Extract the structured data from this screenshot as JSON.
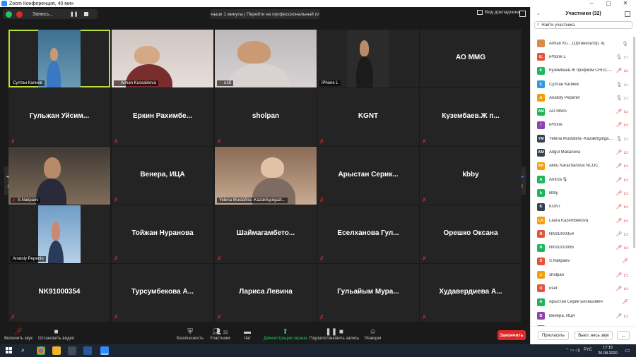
{
  "window": {
    "title": "Zoom Конференция, 40 мин"
  },
  "topbar": {
    "recording_label": "Запись...",
    "time_notice": "Меньше 1 минуты | Перейти на профессиональный план",
    "view_label": "Вид докладчика"
  },
  "pager": {
    "left": "1/2",
    "right": "1/2"
  },
  "tiles": [
    {
      "name": "Султан Калиев",
      "video": true,
      "muted": false,
      "active": true
    },
    {
      "name": "Aiman Kussainova",
      "video": true,
      "muted": true
    },
    {
      "name": "u18",
      "video": true,
      "muted": true
    },
    {
      "name": "iPhone L",
      "video": true,
      "muted": false
    },
    {
      "name": "АО MMG",
      "video": false,
      "muted": false
    },
    {
      "name": "Гульжан Уйсим...",
      "video": false,
      "muted": true
    },
    {
      "name": "Еркин Рахимбе...",
      "video": false,
      "muted": true
    },
    {
      "name": "sholpan",
      "video": false,
      "muted": true
    },
    {
      "name": "KGNT",
      "video": false,
      "muted": true
    },
    {
      "name": "Кузембаев.Ж п...",
      "video": false,
      "muted": true
    },
    {
      "name": "S.Nakpaev",
      "video": true,
      "muted": true
    },
    {
      "name": "Венера, ИЦА",
      "video": false,
      "muted": true
    },
    {
      "name": "Yelena Mustafina -Kazakhgolgazt...",
      "video": true,
      "muted": false
    },
    {
      "name": "Арыстан Серик...",
      "video": false,
      "muted": true
    },
    {
      "name": "kbby",
      "video": false,
      "muted": true
    },
    {
      "name": "Anatoly Pepenin",
      "video": true,
      "muted": false
    },
    {
      "name": "Тойжан Нуранова",
      "video": false,
      "muted": true
    },
    {
      "name": "Шаймагамбето...",
      "video": false,
      "muted": true
    },
    {
      "name": "Еселханова Гул...",
      "video": false,
      "muted": true
    },
    {
      "name": "Орешко Оксана",
      "video": false,
      "muted": true
    },
    {
      "name": "NK91000354",
      "video": false,
      "muted": true
    },
    {
      "name": "Турсумбекова А...",
      "video": false,
      "muted": true
    },
    {
      "name": "Лариса Левина",
      "video": false,
      "muted": true
    },
    {
      "name": "Гульайым Мура...",
      "video": false,
      "muted": true
    },
    {
      "name": "Худавердиева А...",
      "video": false,
      "muted": true
    }
  ],
  "toolbar": {
    "unmute": "Включить звук",
    "video": "Остановить видео",
    "security": "Безопасность",
    "participants": "Участники",
    "participants_count": "32",
    "chat": "Чат",
    "share": "Демонстрация экрана",
    "record": "Пауза/остановить запись",
    "reactions": "Реакции",
    "end": "Закончить"
  },
  "panel": {
    "title": "Участники (32)",
    "search_placeholder": "Найти участника",
    "invite": "Пригласить",
    "mute_all": "Выкл. весь звук",
    "more": "...",
    "participants": [
      {
        "initials": "",
        "name": "Aiman Ku... (Организатор, я)",
        "color": "#d98c4a",
        "muted": false,
        "video": false
      },
      {
        "initials": "iL",
        "name": "iPhone L",
        "color": "#e5533d",
        "muted": false,
        "video": true
      },
      {
        "initials": "K",
        "name": "Кузембаев.Ж профком СНПС-...",
        "color": "#22b45c",
        "muted": true,
        "video": true
      },
      {
        "initials": "С",
        "name": "Султан Калиев",
        "color": "#2d9cdb",
        "muted": false,
        "video": true
      },
      {
        "initials": "A",
        "name": "Anatoly Pepenin",
        "color": "#f59e0b",
        "muted": false,
        "video": true
      },
      {
        "initials": "AM",
        "name": "АО MMG",
        "color": "#22b45c",
        "muted": true,
        "video": true
      },
      {
        "initials": "i",
        "name": "iPhone",
        "color": "#8e44ad",
        "muted": true,
        "video": true
      },
      {
        "initials": "YM",
        "name": "Yelena Mustafina -Kazakhgolgaz...",
        "color": "#374151",
        "muted": false,
        "video": true
      },
      {
        "initials": "AM",
        "name": "Aitgul Makanova",
        "color": "#374151",
        "muted": true,
        "video": true
      },
      {
        "initials": "AK",
        "name": "Akku Karazhanova NCOC",
        "color": "#f59e0b",
        "muted": true,
        "video": true
      },
      {
        "initials": "A",
        "name": "Amirov🎙",
        "color": "#22b45c",
        "muted": true,
        "video": true
      },
      {
        "initials": "k",
        "name": "kbby",
        "color": "#22b45c",
        "muted": true,
        "video": true
      },
      {
        "initials": "K",
        "name": "KGNT",
        "color": "#374151",
        "muted": true,
        "video": true
      },
      {
        "initials": "LK",
        "name": "Laura Kazembekova",
        "color": "#f59e0b",
        "muted": true,
        "video": true
      },
      {
        "initials": "N",
        "name": "NK91000354",
        "color": "#e5533d",
        "muted": true,
        "video": true
      },
      {
        "initials": "N",
        "name": "NK91010085",
        "color": "#22b45c",
        "muted": true,
        "video": true
      },
      {
        "initials": "S",
        "name": "S.Nakpaev",
        "color": "#e5533d",
        "muted": true,
        "video": false
      },
      {
        "initials": "s",
        "name": "sholpan",
        "color": "#f59e0b",
        "muted": true,
        "video": true
      },
      {
        "initials": "U",
        "name": "user",
        "color": "#e5533d",
        "muted": true,
        "video": true
      },
      {
        "initials": "A",
        "name": "Арыстан Серик Бисешович",
        "color": "#22b45c",
        "muted": true,
        "video": false
      },
      {
        "initials": "B",
        "name": "Венера, ИЦА",
        "color": "#8e44ad",
        "muted": true,
        "video": true
      },
      {
        "initials": "Г",
        "name": "Гульжан Муратовна",
        "color": "#22b45c",
        "muted": true,
        "video": true
      }
    ]
  },
  "taskbar": {
    "lang": "РУС",
    "time": "17:15",
    "date": "26.08.2020"
  }
}
